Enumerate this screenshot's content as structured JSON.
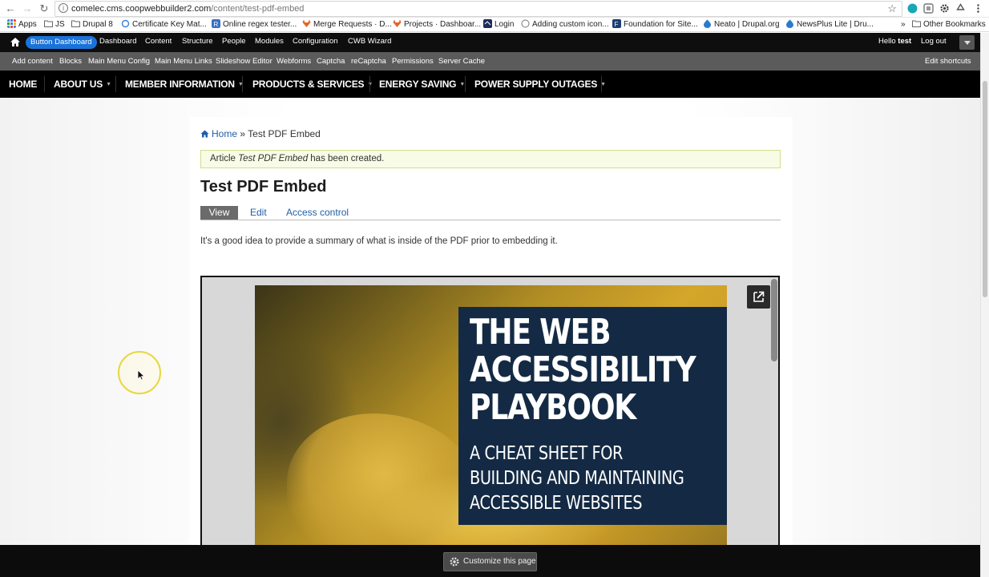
{
  "browser": {
    "url_host": "comelec.cms.coopwebbuilder2.com",
    "url_path": "/content/test-pdf-embed",
    "bookmarks": [
      {
        "label": "Apps",
        "color": "#e44"
      },
      {
        "label": "JS",
        "color": "#888"
      },
      {
        "label": "Drupal 8",
        "color": "#888"
      },
      {
        "label": "Certificate Key Mat...",
        "color": "#3b7dd8"
      },
      {
        "label": "Online regex tester...",
        "color": "#3a6fc4"
      },
      {
        "label": "Merge Requests · D...",
        "color": "#e2662a"
      },
      {
        "label": "Projects · Dashboar...",
        "color": "#e2662a"
      },
      {
        "label": "Login",
        "color": "#1d2a5a"
      },
      {
        "label": "Adding custom icon...",
        "color": "#777"
      },
      {
        "label": "Foundation for Site...",
        "color": "#1b3d72"
      },
      {
        "label": "Neato | Drupal.org",
        "color": "#2a7ad1"
      },
      {
        "label": "NewsPlus Lite | Dru...",
        "color": "#2a7ad1"
      },
      {
        "label": "»",
        "color": ""
      },
      {
        "label": "Other Bookmarks",
        "color": "#888"
      }
    ]
  },
  "admin_toolbar": {
    "button_dashboard": "Button Dashboard",
    "items": [
      "Dashboard",
      "Content",
      "Structure",
      "People",
      "Modules",
      "Configuration",
      "CWB Wizard"
    ],
    "hello_prefix": "Hello ",
    "username": "test",
    "logout": "Log out"
  },
  "shortcuts": {
    "items": [
      "Add content",
      "Blocks",
      "Main Menu Config",
      "Main Menu Links",
      "Slideshow Editor",
      "Webforms",
      "Captcha",
      "reCaptcha",
      "Permissions",
      "Server Cache"
    ],
    "edit": "Edit shortcuts"
  },
  "site_nav": {
    "items": [
      "HOME",
      "ABOUT US",
      "MEMBER INFORMATION",
      "PRODUCTS & SERVICES",
      "ENERGY SAVING",
      "POWER SUPPLY OUTAGES"
    ]
  },
  "breadcrumb": {
    "home": "Home",
    "separator": " » ",
    "current": "Test PDF Embed"
  },
  "status": {
    "prefix": "Article ",
    "title": "Test PDF Embed",
    "suffix": " has been created."
  },
  "page": {
    "title": "Test PDF Embed",
    "tabs": [
      "View",
      "Edit",
      "Access control"
    ],
    "summary": "It's a good idea to provide a summary of what is inside of the PDF prior to embedding it."
  },
  "pdf": {
    "title_lines": [
      "THE WEB",
      "ACCESSIBILITY",
      "PLAYBOOK"
    ],
    "subtitle_lines": [
      "A CHEAT SHEET FOR",
      "BUILDING AND MAINTAINING",
      "ACCESSIBLE WEBSITES"
    ],
    "cover_bg": "#142a44",
    "photo_tone": "#c99e28"
  },
  "footer": {
    "customize": "Customize this page"
  },
  "colors": {
    "accent_link": "#1f5fa8",
    "dashboard_button": "#1a73d9",
    "status_bg": "#f8fbe6"
  }
}
